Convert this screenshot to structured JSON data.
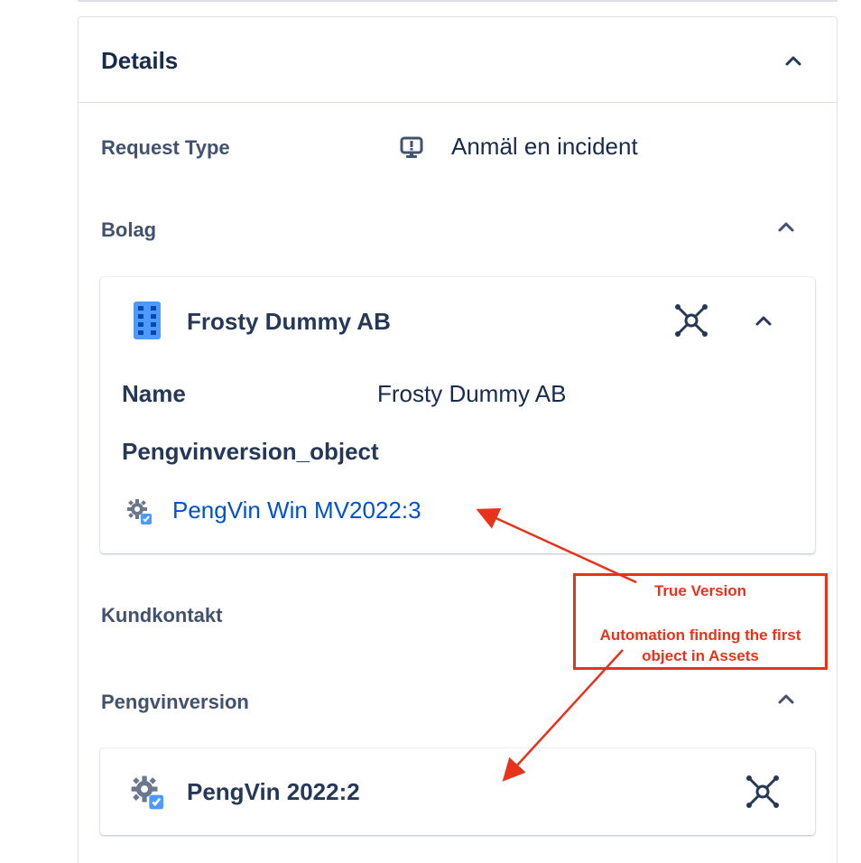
{
  "panel": {
    "title": "Details"
  },
  "request_type": {
    "label": "Request Type",
    "value": "Anmäl en incident",
    "icon": "monitor-alert-icon"
  },
  "bolag": {
    "label": "Bolag",
    "card": {
      "title": "Frosty Dummy AB",
      "icon": "building-icon",
      "fields": [
        {
          "label": "Name",
          "value": "Frosty Dummy AB"
        }
      ],
      "object_field_label": "Pengvinversion_object",
      "object_link": "PengVin Win MV2022:3",
      "object_icon": "gear-icon"
    }
  },
  "kundkontakt": {
    "label": "Kundkontakt"
  },
  "pengvinversion": {
    "label": "Pengvinversion",
    "card": {
      "title": "PengVin 2022:2",
      "icon": "gear-icon"
    }
  },
  "annotation": {
    "line1": "True Version",
    "line2": "Automation finding the first",
    "line3": "object in Assets",
    "color": "#e8331c"
  },
  "colors": {
    "link": "#0052cc",
    "heading": "#172b4d",
    "label": "#42526e",
    "building": "#4c9aff"
  }
}
